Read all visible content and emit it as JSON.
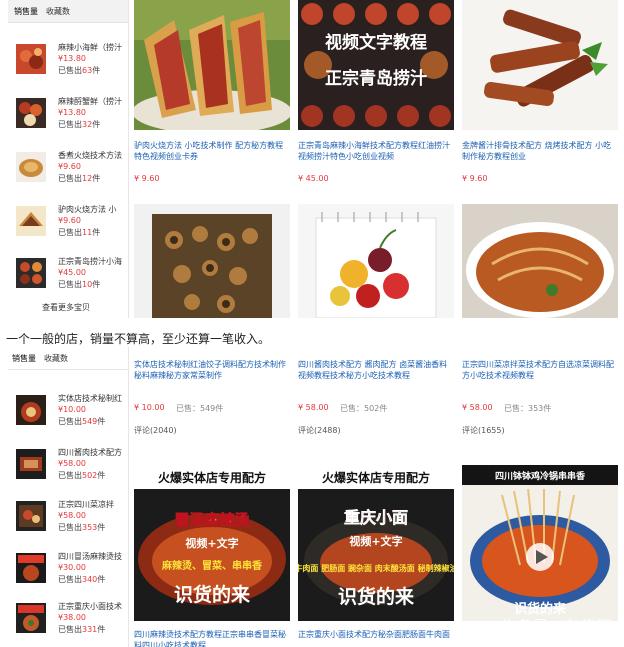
{
  "top": {
    "tabs": [
      "销售量",
      "收藏数"
    ],
    "sidebar_items": [
      {
        "title": "麻辣小海鲜（捞汁",
        "price": "¥13.80",
        "sold_prefix": "已售出",
        "sold_count": "63",
        "sold_suffix": "件"
      },
      {
        "title": "麻辣酹蟹鲜（捞汁",
        "price": "¥13.80",
        "sold_prefix": "已售出",
        "sold_count": "32",
        "sold_suffix": "件"
      },
      {
        "title": "香煮火烧技术方法",
        "price": "¥9.60",
        "sold_prefix": "已售出",
        "sold_count": "12",
        "sold_suffix": "件"
      },
      {
        "title": "驴肉火烧方法 小",
        "price": "¥9.60",
        "sold_prefix": "已售出",
        "sold_count": "11",
        "sold_suffix": "件"
      },
      {
        "title": "正宗青岛捞汁小海",
        "price": "¥45.00",
        "sold_prefix": "已售出",
        "sold_count": "10",
        "sold_suffix": "件"
      }
    ],
    "see_more": "查看更多宝贝",
    "products": [
      {
        "title": "驴肉火烧方法 小吃技术制作 配方秘方教程特色视频创业卡券",
        "price": "¥ 9.60"
      },
      {
        "title": "正宗青岛麻辣小海鲜技术配方教程红油捞汁视频捞汁特色小吃创业视频",
        "price": "¥ 45.00",
        "overlay_line1": "视频文字教程",
        "overlay_line2": "正宗青岛捞汁"
      },
      {
        "title": "金牌酱汁排骨技术配方 烧烤技术配方 小吃制作秘方教程创业",
        "price": "¥ 9.60"
      }
    ]
  },
  "caption": "一个一般的店，销量不算高，至少还算一笔收入。",
  "bottom": {
    "tabs": [
      "销售量",
      "收藏数"
    ],
    "sidebar_items": [
      {
        "title": "实体店技术秘制红",
        "price": "¥10.00",
        "sold_prefix": "已售出",
        "sold_count": "549",
        "sold_suffix": "件"
      },
      {
        "title": "四川酱肉技术配方",
        "price": "¥58.00",
        "sold_prefix": "已售出",
        "sold_count": "502",
        "sold_suffix": "件"
      },
      {
        "title": "正宗四川菜凉拌",
        "price": "¥58.00",
        "sold_prefix": "已售出",
        "sold_count": "353",
        "sold_suffix": "件"
      },
      {
        "title": "四川冒汤麻辣烫技",
        "price": "¥30.00",
        "sold_prefix": "已售出",
        "sold_count": "340",
        "sold_suffix": "件"
      },
      {
        "title": "正宗重庆小面技术",
        "price": "¥38.00",
        "sold_prefix": "已售出",
        "sold_count": "331",
        "sold_suffix": "件"
      }
    ],
    "products": [
      {
        "title": "实体店技术秘制红油饺子调料配方技术制作秘料麻辣秘方家常菜制作",
        "price": "¥ 10.00",
        "sold_label": "已售：",
        "sold": "549件",
        "comment_label": "评论",
        "comment": "(2040)"
      },
      {
        "title": "四川酱肉技术配方 酱肉配方 卤菜酱油香料视频教程技术秘方小吃技术教程",
        "price": "¥ 58.00",
        "sold_label": "已售：",
        "sold": "502件",
        "comment_label": "评论",
        "comment": "(2488)"
      },
      {
        "title": "正宗四川菜凉拌菜技术配方自选凉菜调料配方小吃技术视频教程",
        "price": "¥ 58.00",
        "sold_label": "已售：",
        "sold": "353件",
        "comment_label": "评论",
        "comment": "(1655)"
      }
    ],
    "posters": [
      {
        "banner": "火爆实体店专用配方",
        "name": "冒汤麻辣烫",
        "sub": "视频+文字",
        "tags": "麻辣烫、冒菜、串串香",
        "slogan": "识货的来",
        "title": "四川麻辣烫技术配方教程正宗串串香冒菜秘料四川小吃技术教程"
      },
      {
        "banner": "火爆实体店专用配方",
        "name": "重庆小面",
        "sub": "视频+文字",
        "tags": "牛肉面 肥肠面 豌杂面 肉末酸汤面 秘制辣椒油",
        "slogan": "识货的来",
        "title": "正宗重庆小面技术配方秘杂面肥肠面牛肉面"
      },
      {
        "banner": "四川钵钵鸡冷锅串串香",
        "slogan": "识货的来"
      }
    ]
  },
  "watermark": "头条号 / 有传汇"
}
